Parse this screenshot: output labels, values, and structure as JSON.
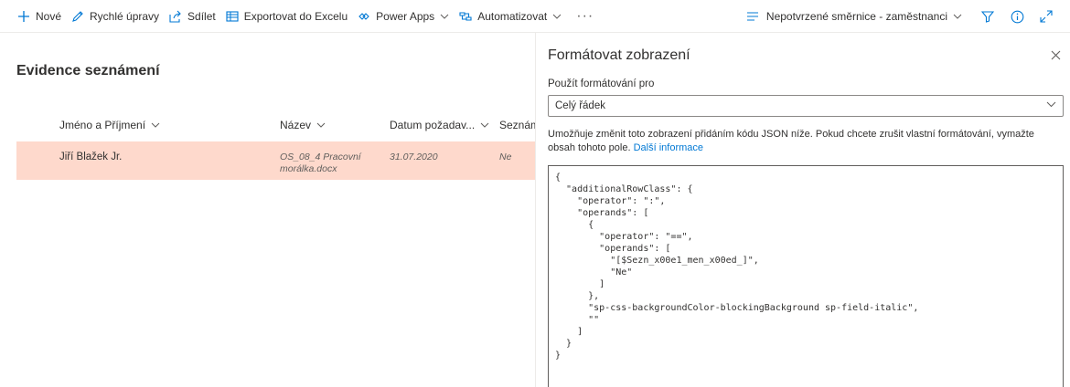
{
  "toolbar": {
    "new_label": "Nové",
    "quick_edit_label": "Rychlé úpravy",
    "share_label": "Sdílet",
    "export_label": "Exportovat do Excelu",
    "powerapps_label": "Power Apps",
    "automate_label": "Automatizovat",
    "more_label": "···",
    "view_name": "Nepotvrzené směrnice - zaměstnanci"
  },
  "list": {
    "title": "Evidence seznámení",
    "columns": [
      "Jméno a Příjmení",
      "Název",
      "Datum požadav...",
      "Seznám"
    ],
    "rows": [
      {
        "name": "Jiří Blažek Jr.",
        "doc_line1": "OS_08_4 Pracovní",
        "doc_line2": "morálka.docx",
        "date": "31.07.2020",
        "ack": "Ne"
      }
    ]
  },
  "panel": {
    "title": "Formátovat zobrazení",
    "apply_label": "Použít formátování pro",
    "apply_value": "Celý řádek",
    "description": "Umožňuje změnit toto zobrazení přidáním kódu JSON níže. Pokud chcete zrušit vlastní formátování, vymažte obsah tohoto pole.",
    "more_info_link": "Další informace",
    "json_code": "{\n  \"additionalRowClass\": {\n    \"operator\": \":\",\n    \"operands\": [\n      {\n        \"operator\": \"==\",\n        \"operands\": [\n          \"[$Sezn_x00e1_men_x00ed_]\",\n          \"Ne\"\n        ]\n      },\n      \"sp-css-backgroundColor-blockingBackground sp-field-italic\",\n      \"\"\n    ]\n  }\n}"
  },
  "colors": {
    "accent": "#0078d4",
    "row_highlight": "#fed9cc",
    "text": "#323130"
  },
  "icons": [
    "add-icon",
    "edit-icon",
    "share-icon",
    "excel-icon",
    "powerapps-icon",
    "automate-icon",
    "view-list-icon",
    "filter-icon",
    "info-icon",
    "expand-icon",
    "close-icon",
    "chevron-down-icon"
  ]
}
